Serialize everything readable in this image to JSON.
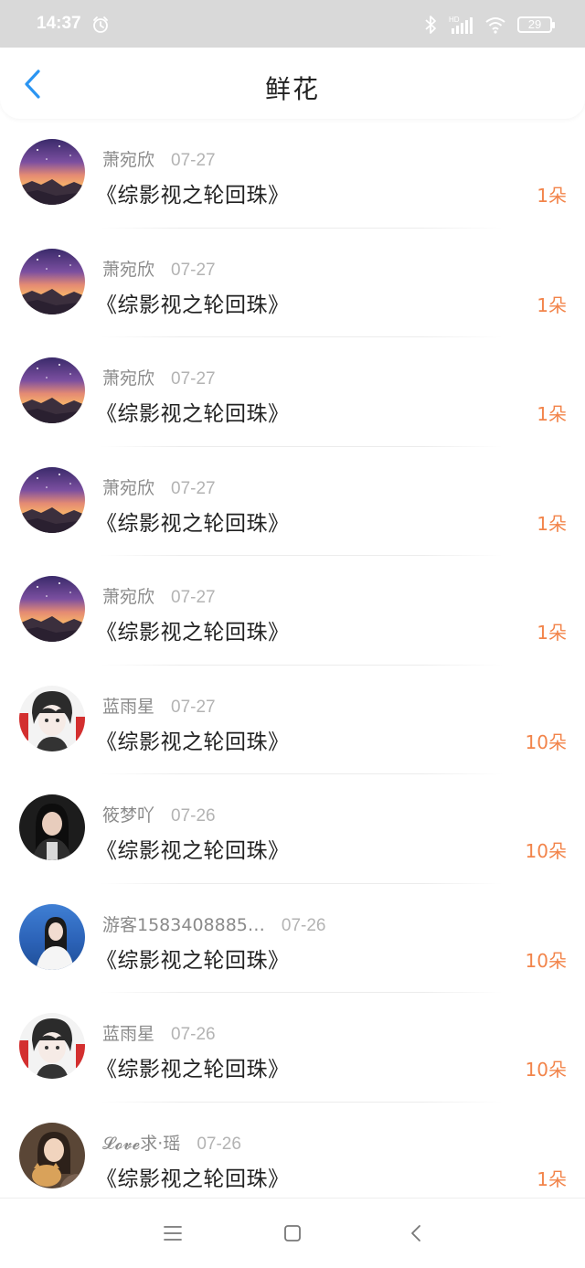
{
  "status_bar": {
    "time": "14:37",
    "battery": "29",
    "network": "HD",
    "icons": [
      "alarm-icon",
      "bluetooth-icon",
      "signal-icon",
      "wifi-icon",
      "battery-icon"
    ]
  },
  "header": {
    "title": "鲜花",
    "back_icon": "chevron-left-icon"
  },
  "colors": {
    "accent": "#2b95f2",
    "count": "#f2844a",
    "name": "#8a8a8a",
    "date": "#b3b3b3",
    "title": "#222222"
  },
  "items": [
    {
      "name": "萧宛欣",
      "date": "07-27",
      "book": "《综影视之轮回珠》",
      "count": "1朵",
      "avatar": "sunset-avatar"
    },
    {
      "name": "萧宛欣",
      "date": "07-27",
      "book": "《综影视之轮回珠》",
      "count": "1朵",
      "avatar": "sunset-avatar"
    },
    {
      "name": "萧宛欣",
      "date": "07-27",
      "book": "《综影视之轮回珠》",
      "count": "1朵",
      "avatar": "sunset-avatar"
    },
    {
      "name": "萧宛欣",
      "date": "07-27",
      "book": "《综影视之轮回珠》",
      "count": "1朵",
      "avatar": "sunset-avatar"
    },
    {
      "name": "萧宛欣",
      "date": "07-27",
      "book": "《综影视之轮回珠》",
      "count": "1朵",
      "avatar": "sunset-avatar"
    },
    {
      "name": "蓝雨星",
      "date": "07-27",
      "book": "《综影视之轮回珠》",
      "count": "10朵",
      "avatar": "anime-boy-avatar"
    },
    {
      "name": "筱梦吖",
      "date": "07-26",
      "book": "《综影视之轮回珠》",
      "count": "10朵",
      "avatar": "girl-dark-avatar"
    },
    {
      "name": "游客1583408885…",
      "date": "07-26",
      "book": "《综影视之轮回珠》",
      "count": "10朵",
      "avatar": "girl-sea-avatar"
    },
    {
      "name": "蓝雨星",
      "date": "07-26",
      "book": "《综影视之轮回珠》",
      "count": "10朵",
      "avatar": "anime-boy-avatar"
    },
    {
      "name": "𝓛𝓸𝓿𝓮求·瑶",
      "date": "07-26",
      "book": "《综影视之轮回珠》",
      "count": "1朵",
      "avatar": "girl-cat-avatar"
    }
  ],
  "bottom_nav": {
    "icons": [
      "menu-icon",
      "home-square-icon",
      "back-triangle-icon"
    ]
  }
}
